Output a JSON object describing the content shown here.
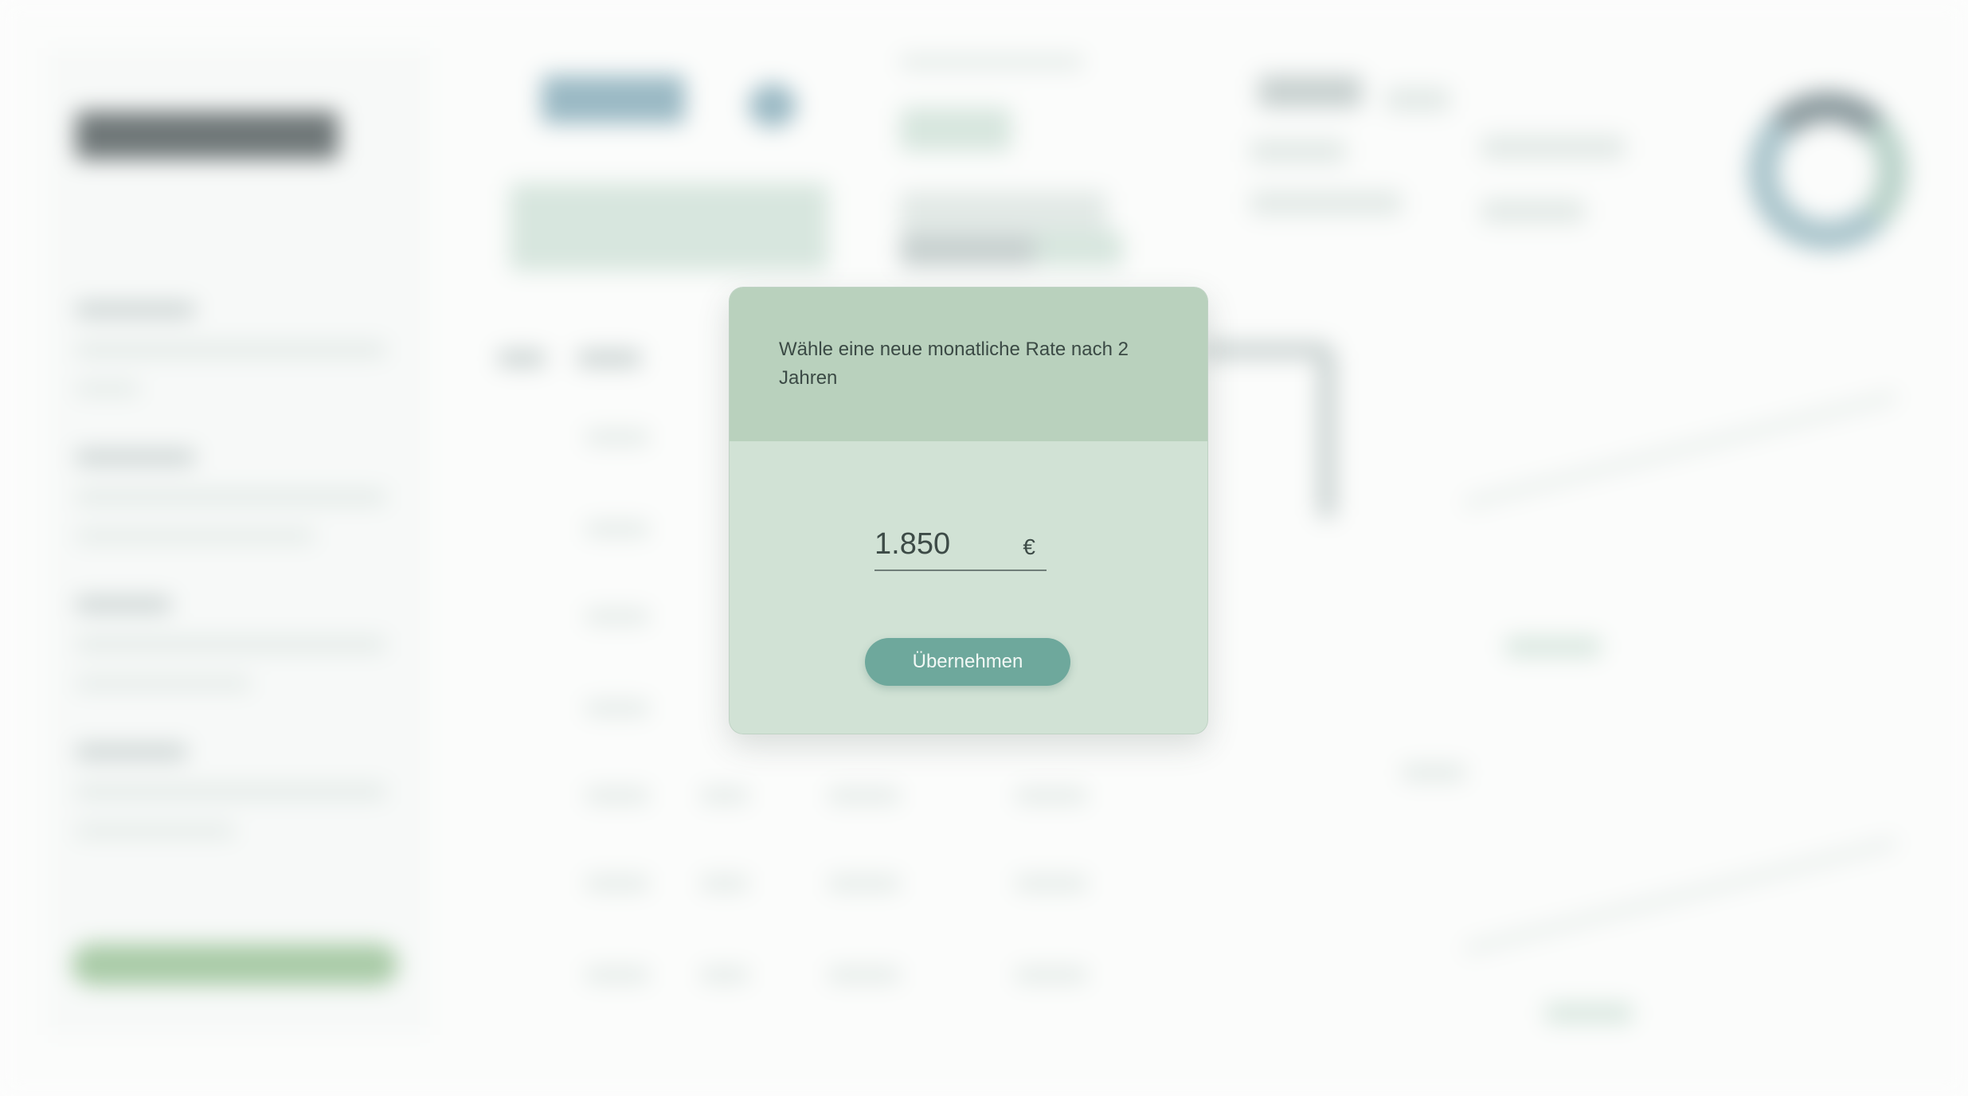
{
  "modal": {
    "title": "Wähle eine neue monatliche Rate nach 2 Jahren",
    "amount_value": "1.850",
    "currency": "€",
    "apply_label": "Übernehmen"
  },
  "colors": {
    "modal_bg": "#cfe0d3",
    "modal_header_bg": "#b8d0bb",
    "button_bg": "#6ea89c",
    "text": "#3b4a45"
  }
}
